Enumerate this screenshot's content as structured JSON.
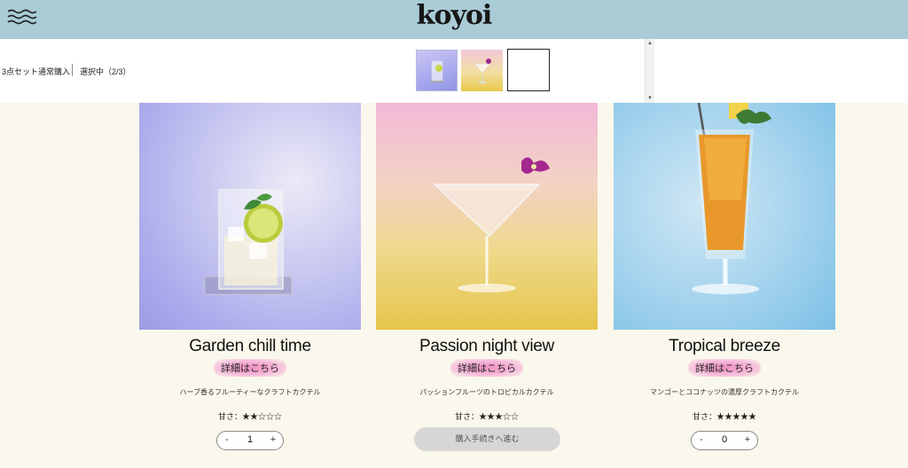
{
  "header": {
    "logo": "koyoi",
    "menu_icon": "wavy-menu-icon"
  },
  "selection": {
    "set_label": "3点セット通常購入",
    "status": "選択中（2/3）",
    "thumbnails": [
      "Garden chill time",
      "Passion night view",
      "empty-slot"
    ]
  },
  "products": [
    {
      "title": "Garden chill time",
      "detail_label": "詳細はこちら",
      "description": "ハーブ香るフルーティーなクラフトカクテル",
      "sweetness": "甘さ：★★☆☆☆",
      "quantity": "1",
      "minus": "-",
      "plus": "+"
    },
    {
      "title": "Passion night view",
      "detail_label": "詳細はこちら",
      "description": "パッションフルーツのトロピカルカクテル",
      "sweetness": "甘さ：★★★☆☆",
      "checkout_label": "購入手続きへ進む"
    },
    {
      "title": "Tropical breeze",
      "detail_label": "詳細はこちら",
      "description": "マンゴーとココナッツの濃厚クラフトカクテル",
      "sweetness": "甘さ：★★★★★",
      "quantity": "0",
      "minus": "-",
      "plus": "+"
    }
  ],
  "colors": {
    "header_bg": "#a9ccd6",
    "page_bg": "#faf8ec",
    "highlight_pink": "#f08fc3",
    "checkout_bg": "#d6d6d6"
  }
}
